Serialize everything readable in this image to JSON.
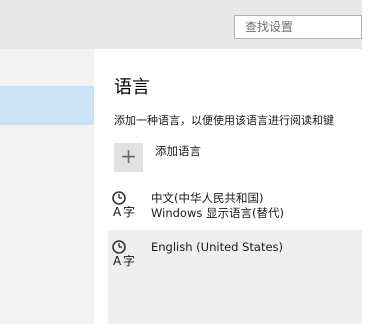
{
  "search": {
    "placeholder": "查找设置"
  },
  "language_page": {
    "title": "语言",
    "description": "添加一种语言，以便使用该语言进行阅读和键",
    "add_language_label": "添加语言",
    "languages": [
      {
        "name": "中文(中华人民共和国)",
        "subtitle": "Windows 显示语言(替代)"
      },
      {
        "name": "English (United States)",
        "subtitle": ""
      }
    ]
  },
  "icons": {
    "add": "plus-icon",
    "language": "language-icon"
  },
  "colors": {
    "topbar": "#e8e8e8",
    "sidebar": "#f2f2f2",
    "sidebar_selected": "#cbe2f7",
    "selected_language_bg": "#efefef"
  }
}
